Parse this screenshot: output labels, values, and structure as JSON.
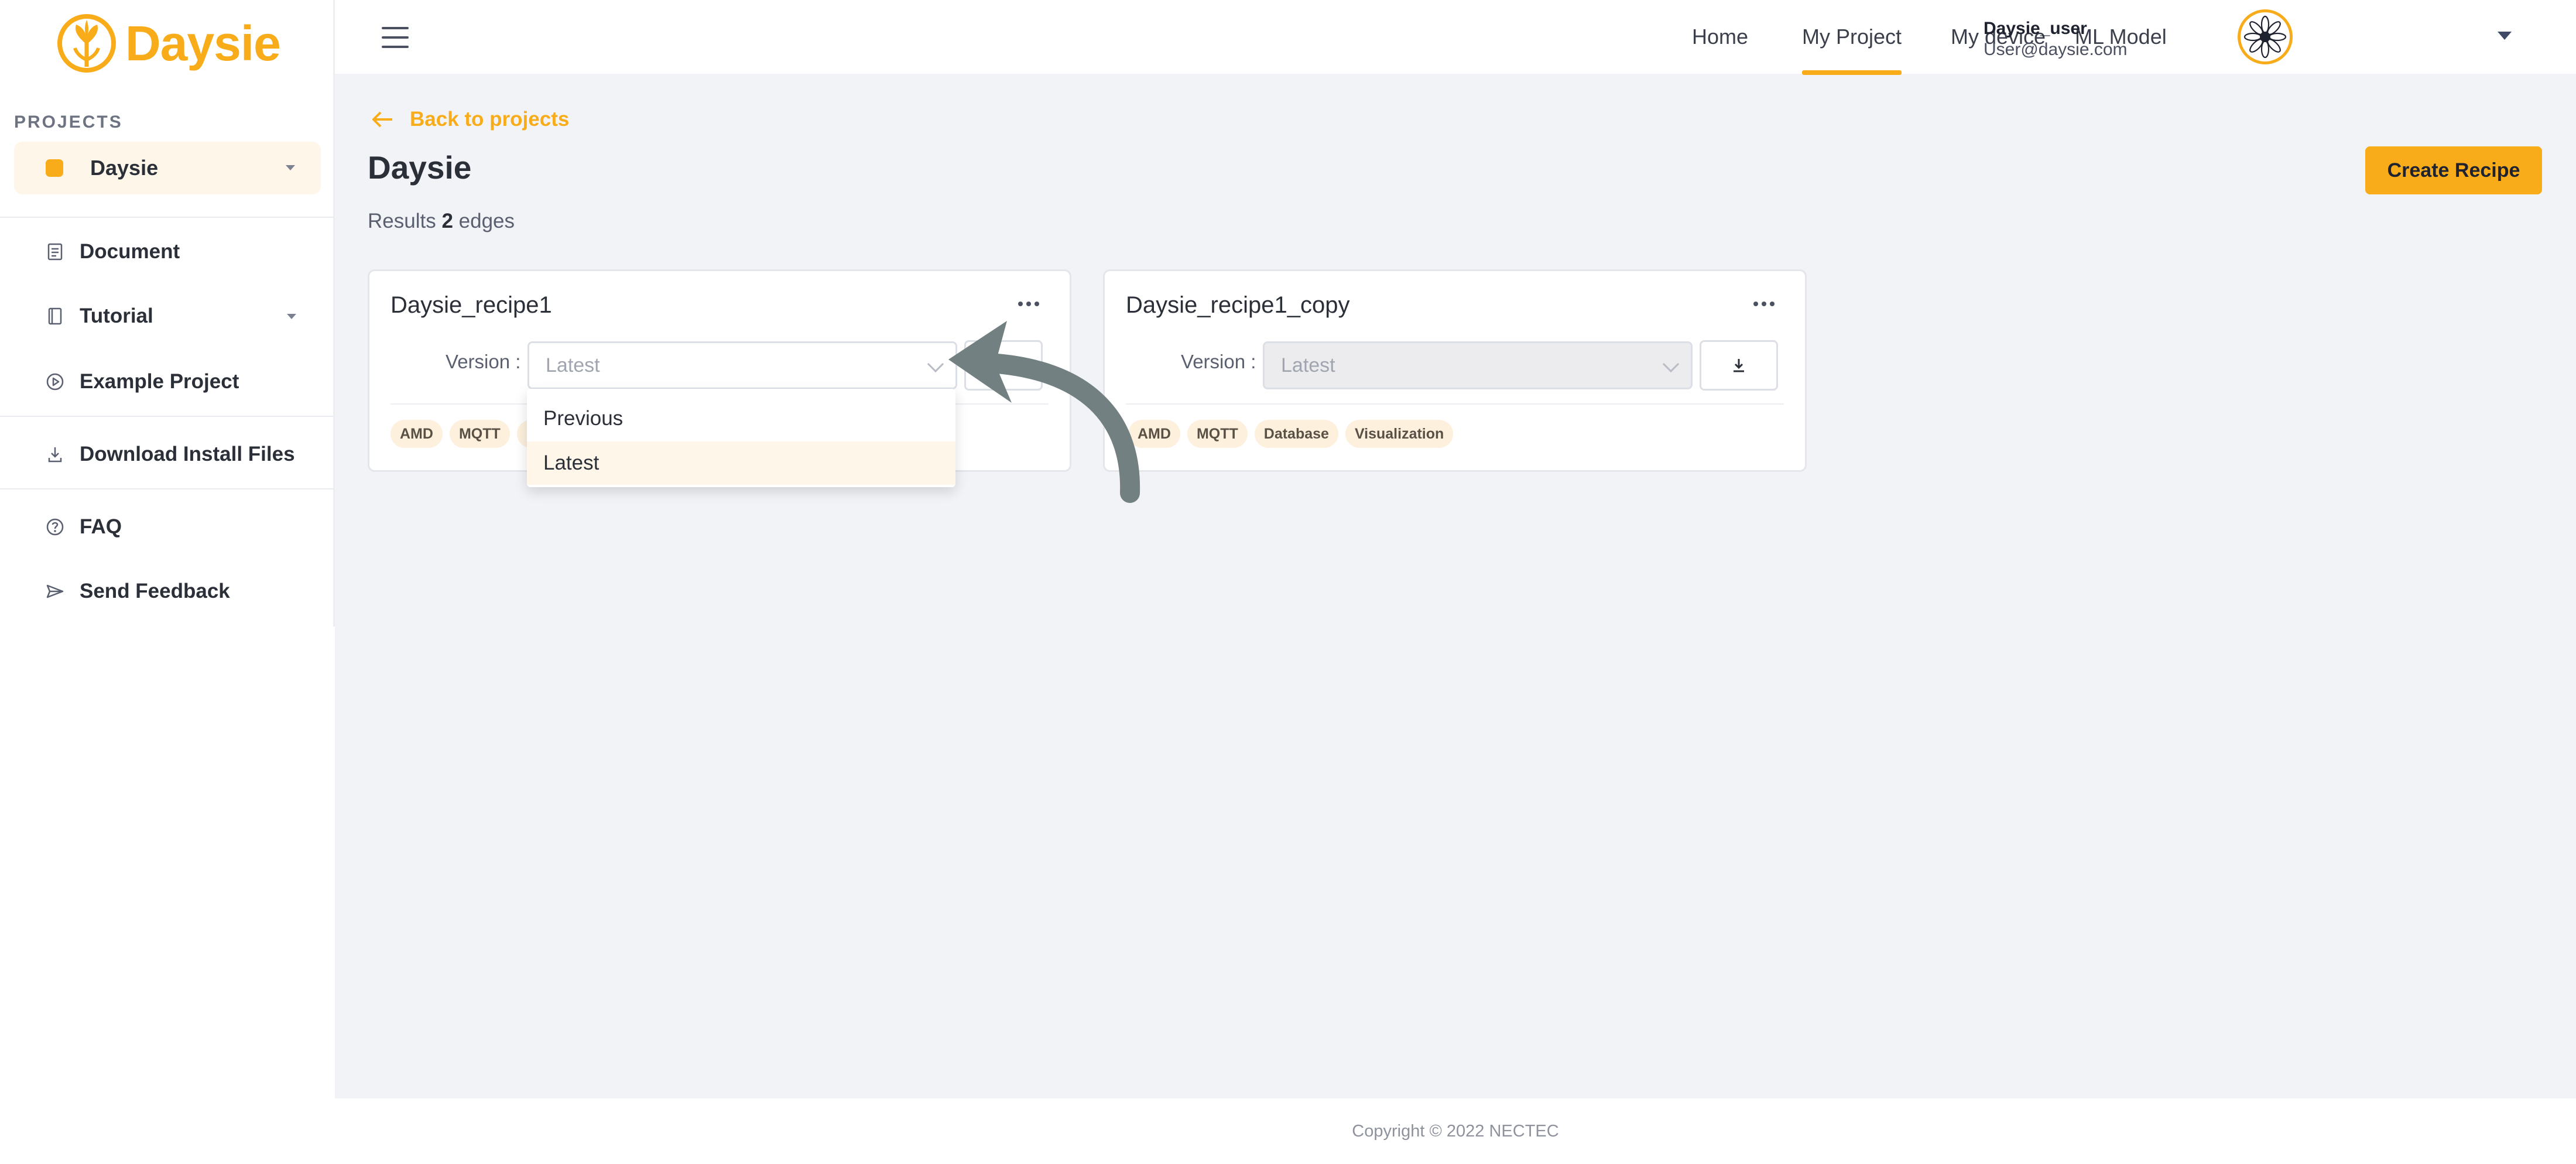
{
  "app": {
    "logo_text": "Daysie",
    "brand_color": "#f9ac1a"
  },
  "sidebar": {
    "section_label": "PROJECTS",
    "current_project": "Daysie",
    "items": [
      {
        "label": "Document",
        "icon": "document-icon"
      },
      {
        "label": "Tutorial",
        "icon": "book-icon",
        "has_submenu": true
      },
      {
        "label": "Example Project",
        "icon": "play-circle-icon"
      },
      {
        "label": "Download Install Files",
        "icon": "download-icon"
      },
      {
        "label": "FAQ",
        "icon": "question-circle-icon"
      },
      {
        "label": "Send Feedback",
        "icon": "send-icon"
      }
    ]
  },
  "topnav": {
    "items": [
      "Home",
      "My Project",
      "My device",
      "ML Model"
    ],
    "active": "My Project",
    "user": {
      "name": "Daysie_user",
      "email": "User@daysie.com"
    }
  },
  "page": {
    "back_label": "Back to projects",
    "title": "Daysie",
    "results_prefix": "Results",
    "results_count": "2",
    "results_suffix": "edges",
    "create_button": "Create Recipe"
  },
  "cards": [
    {
      "title": "Daysie_recipe1",
      "version_label": "Version :",
      "version_value": "Latest",
      "tags": [
        "AMD",
        "MQTT",
        "Dat"
      ]
    },
    {
      "title": "Daysie_recipe1_copy",
      "version_label": "Version :",
      "version_value": "Latest",
      "tags": [
        "AMD",
        "MQTT",
        "Database",
        "Visualization"
      ]
    }
  ],
  "dropdown": {
    "options": [
      "Previous",
      "Latest"
    ],
    "selected": "Latest"
  },
  "footer": {
    "copyright": "Copyright © 2022 NECTEC"
  }
}
